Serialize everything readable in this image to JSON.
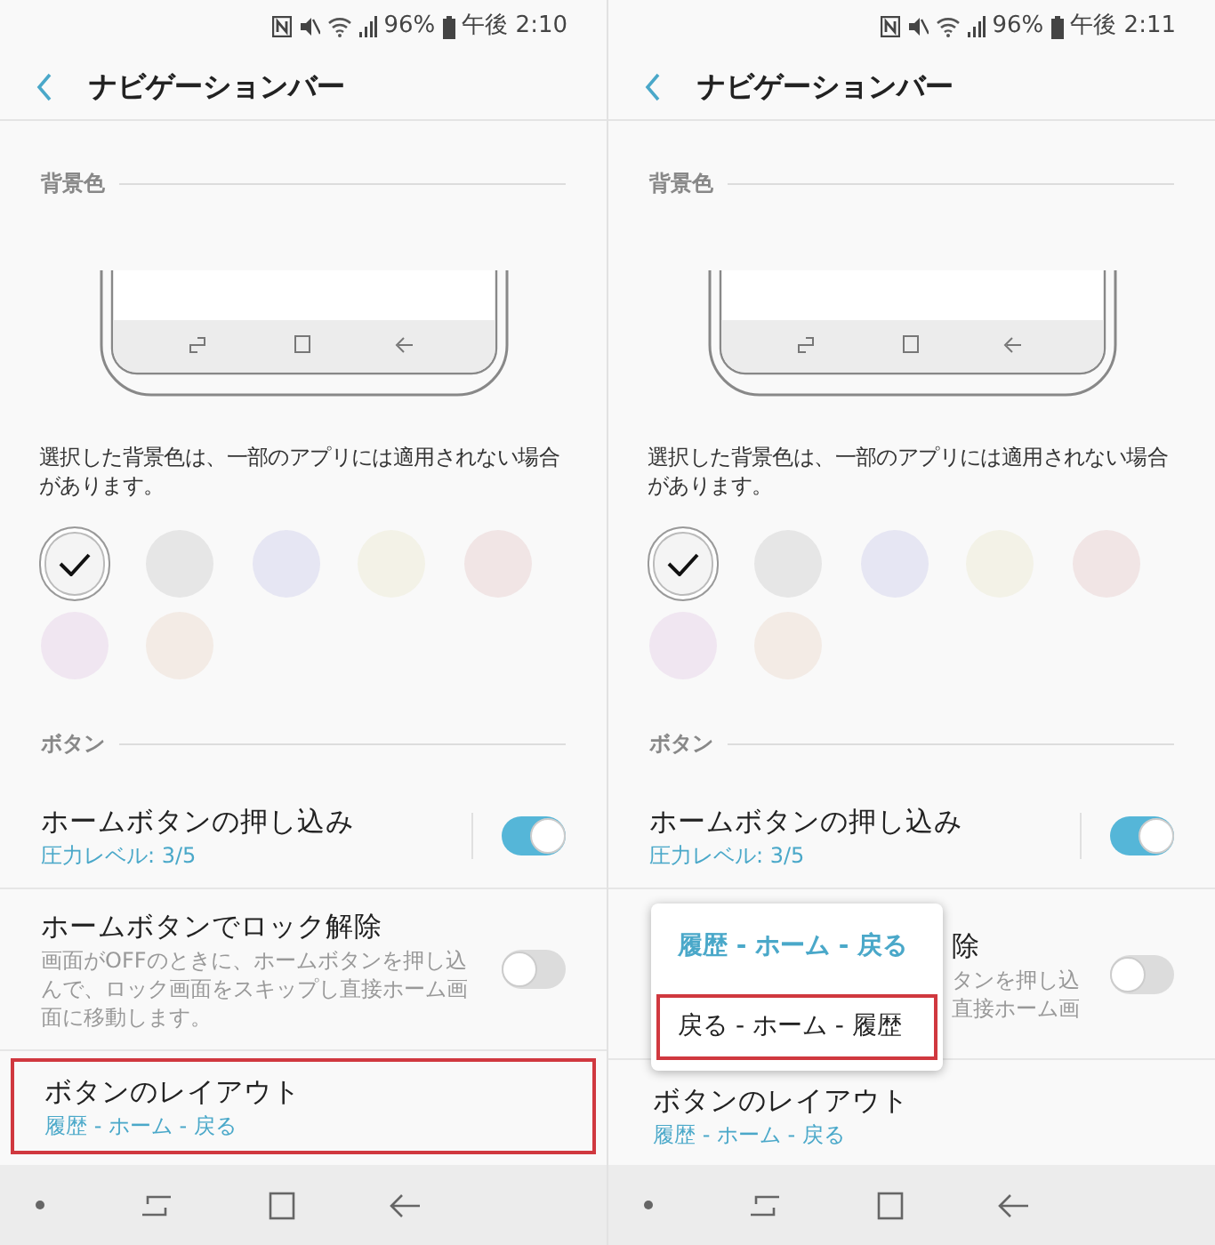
{
  "screens": [
    {
      "status": {
        "battery": "96%",
        "time": "午後 2:10"
      },
      "title": "ナビゲーションバー",
      "background_section": {
        "label": "背景色",
        "note": "選択した背景色は、一部のアプリには適用されない場合があります。",
        "colors": [
          {
            "color": "#f4f4f4",
            "selected": true
          },
          {
            "color": "#e6e6e6",
            "selected": false
          },
          {
            "color": "#e6e6f3",
            "selected": false
          },
          {
            "color": "#f3f2e7",
            "selected": false
          },
          {
            "color": "#f1e5e5",
            "selected": false
          },
          {
            "color": "#f0e6f1",
            "selected": false
          },
          {
            "color": "#f3ebe5",
            "selected": false
          }
        ]
      },
      "buttons_section": {
        "label": "ボタン",
        "items": [
          {
            "kind": "toggle",
            "title": "ホームボタンの押し込み",
            "subtitle": "圧力レベル: 3/5",
            "on": true,
            "divided": true
          },
          {
            "kind": "toggle",
            "title": "ホームボタンでロック解除",
            "description_lines": [
              "画面がOFFのときに、ホームボタンを押し込",
              "んで、ロック画面をスキップし直接ホーム画",
              "面に移動します。"
            ],
            "on": false
          },
          {
            "kind": "option",
            "title": "ボタンのレイアウト",
            "value": "履歴 - ホーム - 戻る",
            "highlighted": true
          }
        ]
      }
    },
    {
      "status": {
        "battery": "96%",
        "time": "午後 2:11"
      },
      "title": "ナビゲーションバー",
      "background_section": {
        "label": "背景色",
        "note": "選択した背景色は、一部のアプリには適用されない場合があります。",
        "colors": [
          {
            "color": "#f4f4f4",
            "selected": true
          },
          {
            "color": "#e6e6e6",
            "selected": false
          },
          {
            "color": "#e6e6f3",
            "selected": false
          },
          {
            "color": "#f3f2e7",
            "selected": false
          },
          {
            "color": "#f1e5e5",
            "selected": false
          },
          {
            "color": "#f0e6f1",
            "selected": false
          },
          {
            "color": "#f3ebe5",
            "selected": false
          }
        ]
      },
      "buttons_section": {
        "label": "ボタン",
        "items": [
          {
            "kind": "toggle",
            "title": "ホームボタンの押し込み",
            "subtitle": "圧力レベル: 3/5",
            "on": true,
            "divided": true
          },
          {
            "kind": "covered_toggle",
            "title": "除",
            "description_lines": [
              "タンを押し込",
              "直接ホーム画"
            ],
            "on": false
          },
          {
            "kind": "option",
            "title": "ボタンのレイアウト",
            "value": "履歴 - ホーム - 戻る"
          }
        ]
      },
      "popup": {
        "options": [
          {
            "label": "履歴 - ホーム - 戻る",
            "selected": true,
            "highlighted": false
          },
          {
            "label": "戻る - ホーム - 履歴",
            "selected": false,
            "highlighted": true
          }
        ]
      }
    }
  ]
}
